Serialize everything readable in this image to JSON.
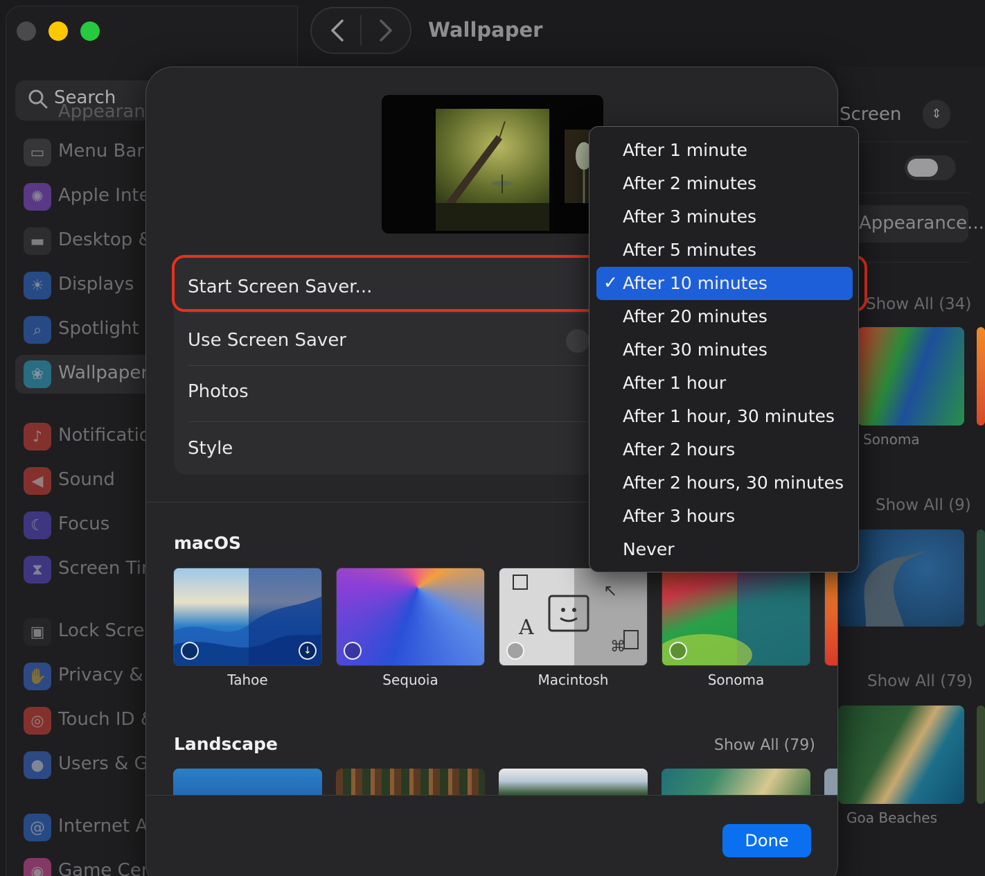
{
  "window": {
    "title": "Wallpaper"
  },
  "sidebar": {
    "search_placeholder": "Search",
    "ghost_item": "Appearance",
    "items": [
      {
        "label": "Menu Bar",
        "icon": "menubar-icon",
        "color": "#4a4a4e"
      },
      {
        "label": "Apple Intelligence & Siri",
        "icon": "apple-intelligence-icon",
        "color": "#8a4fd8"
      },
      {
        "label": "Desktop & Dock",
        "icon": "dock-icon",
        "color": "#3a3a3e"
      },
      {
        "label": "Displays",
        "icon": "sun-icon",
        "color": "#2f6fd8"
      },
      {
        "label": "Spotlight",
        "icon": "spotlight-icon",
        "color": "#2f6fd8"
      },
      {
        "label": "Wallpaper",
        "icon": "wallpaper-icon",
        "color": "#27a3c9",
        "active": true
      },
      {
        "label": "Notifications",
        "icon": "bell-icon",
        "color": "#d9413b"
      },
      {
        "label": "Sound",
        "icon": "speaker-icon",
        "color": "#d9413b"
      },
      {
        "label": "Focus",
        "icon": "moon-icon",
        "color": "#5a4bd0"
      },
      {
        "label": "Screen Time",
        "icon": "hourglass-icon",
        "color": "#5a4bd0"
      },
      {
        "label": "Lock Screen",
        "icon": "lock-icon",
        "color": "#2b2b2e"
      },
      {
        "label": "Privacy & Security",
        "icon": "hand-icon",
        "color": "#3a6fd8"
      },
      {
        "label": "Touch ID & Password",
        "icon": "fingerprint-icon",
        "color": "#d9413b"
      },
      {
        "label": "Users & Groups",
        "icon": "users-icon",
        "color": "#3a6fd8"
      },
      {
        "label": "Internet Accounts",
        "icon": "at-icon",
        "color": "#2f6fd8"
      },
      {
        "label": "Game Center",
        "icon": "game-center-icon",
        "color": "#d94fa0"
      }
    ]
  },
  "right_panel": {
    "screen_label": "Screen",
    "appearance_label": "Appearance...",
    "showall_1": "Show All (34)",
    "caption_1": "Sonoma",
    "showall_2": "Show All (9)",
    "showall_3": "Show All (79)",
    "caption_3": "Goa Beaches"
  },
  "sheet": {
    "rows": {
      "start": "Start Screen Saver...",
      "use": "Use Screen Saver",
      "photos": "Photos",
      "style": "Style"
    },
    "macos_heading": "macOS",
    "wallpapers": [
      {
        "name": "Tahoe"
      },
      {
        "name": "Sequoia"
      },
      {
        "name": "Macintosh"
      },
      {
        "name": "Sonoma"
      }
    ],
    "landscape_heading": "Landscape",
    "landscape_showall": "Show All (79)",
    "done_label": "Done"
  },
  "menu": {
    "selected_index": 4,
    "items": [
      "After 1 minute",
      "After 2 minutes",
      "After 3 minutes",
      "After 5 minutes",
      "After 10 minutes",
      "After 20 minutes",
      "After 30 minutes",
      "After 1 hour",
      "After 1 hour, 30 minutes",
      "After 2 hours",
      "After 2 hours, 30 minutes",
      "After 3 hours",
      "Never"
    ],
    "check_glyph": "✓"
  },
  "colors": {
    "accent": "#1d5fd8",
    "done_button": "#0a70f0",
    "highlight": "#e8301e"
  }
}
